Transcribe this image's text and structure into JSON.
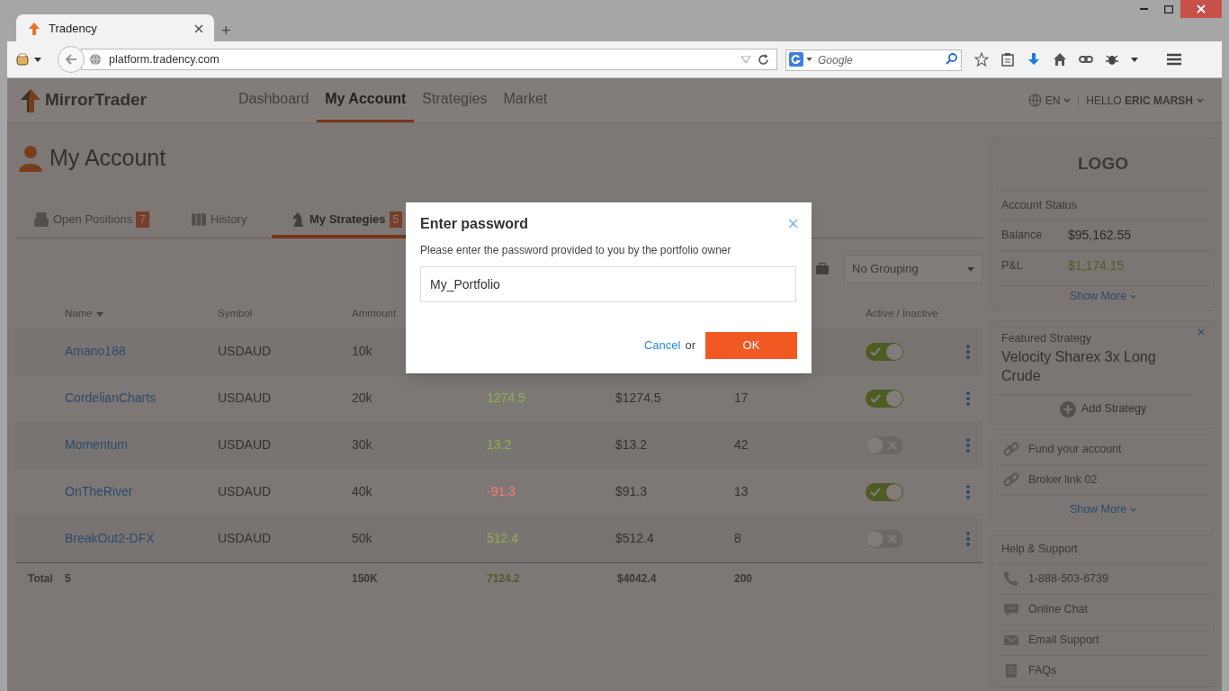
{
  "browser": {
    "tabs": [
      {
        "title": "Tradency",
        "selected": true
      }
    ],
    "new_tab": "+",
    "url": "platform.tradency.com",
    "search_placeholder": "Google"
  },
  "app": {
    "brand": "MirrorTrader",
    "nav": [
      {
        "label": "Dashboard",
        "selected": false
      },
      {
        "label": "My Account",
        "selected": true
      },
      {
        "label": "Strategies",
        "selected": false
      },
      {
        "label": "Market",
        "selected": false
      }
    ],
    "language": "EN",
    "greeting": "HELLO **ERIC MARSH**"
  },
  "page_title": "My Account",
  "tabs": [
    {
      "label": "Open Positions",
      "count": "7",
      "selected": false
    },
    {
      "label": "History",
      "selected": false
    },
    {
      "label": "My Strategies",
      "count": "5",
      "selected": true
    }
  ],
  "grouping": "No Grouping",
  "table": {
    "columns": [
      "Name",
      "Symbol",
      "Ammount",
      "Active / Inactive"
    ],
    "rows": [
      {
        "name": "Amano188",
        "symbol": "USDAUD",
        "amount": "10k",
        "active": true
      },
      {
        "name": "CordelianCharts",
        "symbol": "USDAUD",
        "amount": "20k",
        "column_4": {
          "text": "1274.5",
          "color": "#8fb24a"
        },
        "column_5": "$1274.5",
        "column_6": "17",
        "active": true
      },
      {
        "name": "Momentum",
        "symbol": "USDAUD",
        "amount": "30k",
        "column_4": {
          "text": "13.2",
          "color": "#8fb24a"
        },
        "column_5": "$13.2",
        "column_6": "42",
        "active": false
      },
      {
        "name": "OnTheRiver",
        "symbol": "USDAUD",
        "amount": "40k",
        "column_4": {
          "text": "-91.3",
          "color": "#ff7a6e"
        },
        "column_5": "$91.3",
        "column_6": "13",
        "active": true
      },
      {
        "name": "BreakOut2-DFX",
        "symbol": "USDAUD",
        "amount": "50k",
        "column_4": {
          "text": "512.4",
          "color": "#8fb24a"
        },
        "column_5": "$512.4",
        "column_6": "8",
        "active": false
      }
    ],
    "total": {
      "label": "Total",
      "count": "5",
      "amount": "150K",
      "column_4": "7124.2",
      "column_5": "$4042.4",
      "column_6": "200"
    }
  },
  "sidebar": {
    "logo": "LOGO",
    "account_status": "Account Status",
    "balance_label": "Balance",
    "balance": "$95,162.55",
    "pnl_label": "P&L",
    "pnl": "$1,174.15",
    "show_more": "Show More",
    "featured_label": "Featured Strategy",
    "featured": "Velocity Sharex 3x Long Crude",
    "add_strategy": "Add Strategy",
    "links": [
      "Fund your account",
      "Broker link 02"
    ],
    "links_show_more": "Show More",
    "help_title": "Help & Support",
    "help": [
      {
        "kind": "phone",
        "label": "1-888-503-6739"
      },
      {
        "kind": "chat",
        "label": "Online Chat"
      },
      {
        "kind": "email",
        "label": "Email Support"
      },
      {
        "kind": "faq",
        "label": "FAQs"
      }
    ]
  },
  "dialog": {
    "title": "Enter password",
    "close": "×",
    "message": "Please enter the password provided to you by the portfolio owner",
    "value": "My_Portfolio",
    "cancel": "Cancel",
    "or": "or",
    "ok": "OK"
  }
}
